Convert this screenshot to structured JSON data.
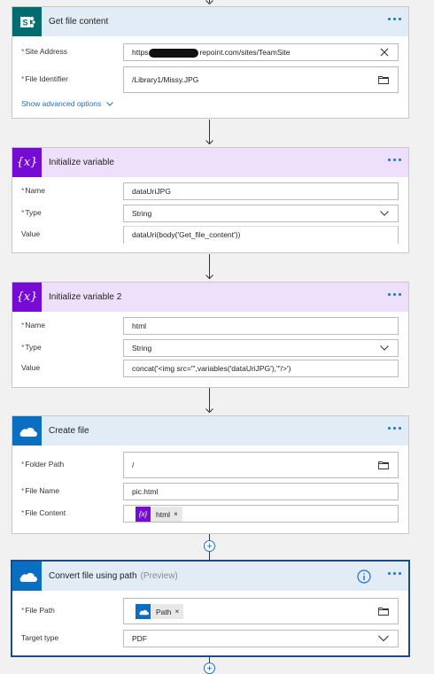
{
  "cards": {
    "get_file_content": {
      "title": "Get file content",
      "site_address_label": "Site Address",
      "site_address_prefix": "https",
      "site_address_suffix": "repoint.com/sites/TeamSite",
      "file_identifier_label": "File Identifier",
      "file_identifier_value": "/Library1/Missy.JPG",
      "advanced_options": "Show advanced options"
    },
    "init_var_1": {
      "title": "Initialize variable",
      "name_label": "Name",
      "name_value": "dataUriJPG",
      "type_label": "Type",
      "type_value": "String",
      "value_label": "Value",
      "value_value": "dataUri(body('Get_file_content'))"
    },
    "init_var_2": {
      "title": "Initialize variable 2",
      "name_label": "Name",
      "name_value": "html",
      "type_label": "Type",
      "type_value": "String",
      "value_label": "Value",
      "value_value": "concat('<img src=\"',variables('dataUriJPG'),'\"/>')"
    },
    "create_file": {
      "title": "Create file",
      "folder_path_label": "Folder Path",
      "folder_path_value": "/",
      "file_name_label": "File Name",
      "file_name_value": "pic.html",
      "file_content_label": "File Content",
      "file_content_token": "html"
    },
    "convert_file": {
      "title": "Convert file using path",
      "preview": "(Preview)",
      "file_path_label": "File Path",
      "file_path_token": "Path",
      "target_type_label": "Target type",
      "target_type_value": "PDF"
    }
  },
  "icons": {
    "variable_glyph": "{x}",
    "token_close": "×",
    "plus": "+"
  },
  "colors": {
    "sharepoint_blue": "#036c70",
    "variable_purple": "#770bd6",
    "onedrive_blue": "#0a6fc2",
    "header_blue_tint": "#e2ecf7",
    "header_purple_tint": "#eee0fa",
    "link_blue": "#1e6fd0",
    "selected_border": "#1e4a8c"
  }
}
